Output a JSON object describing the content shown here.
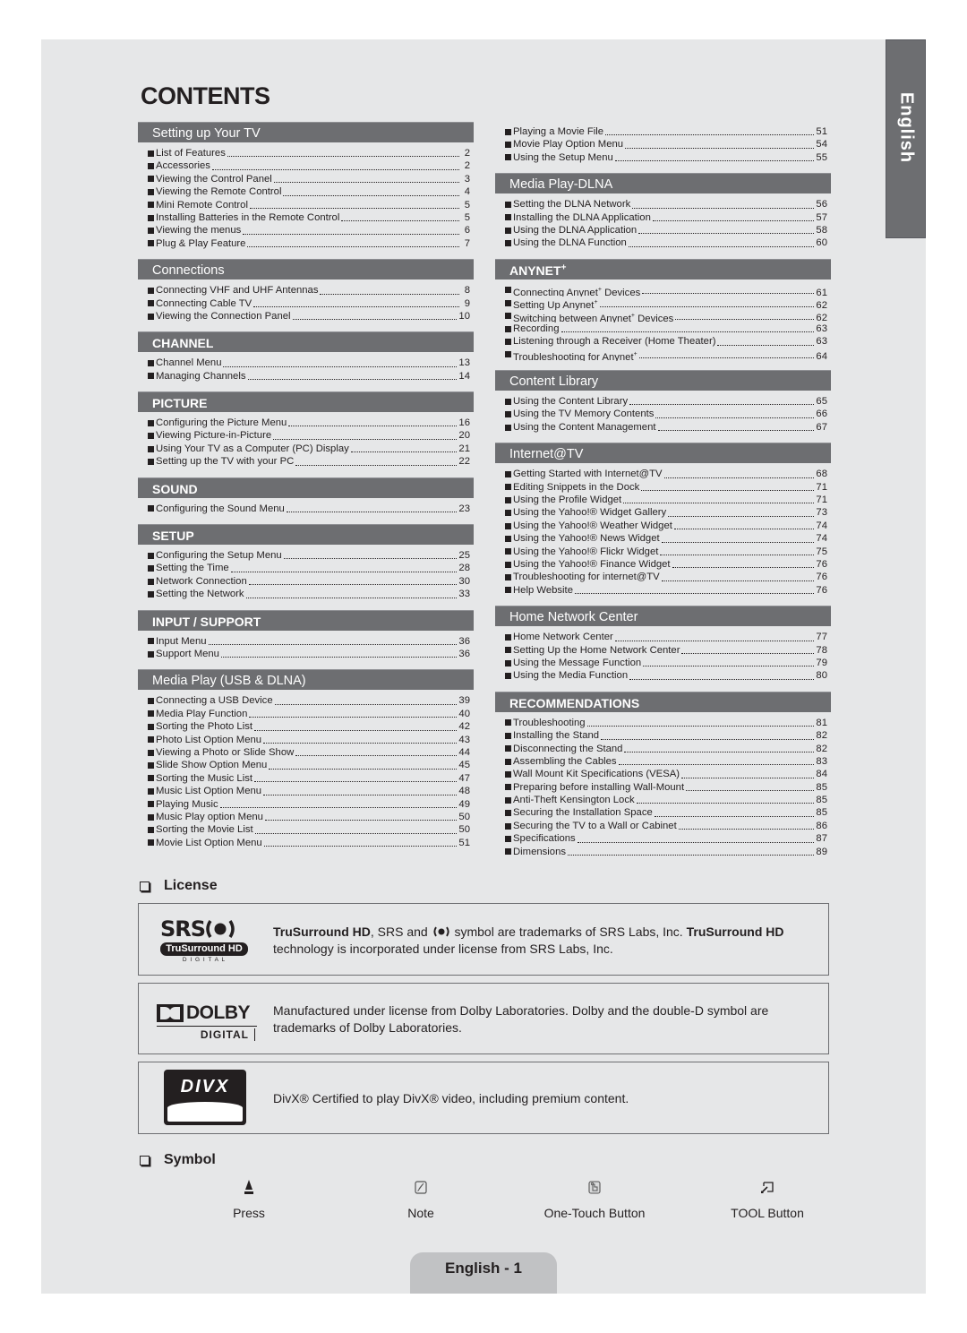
{
  "language_tab": "English",
  "title": "CONTENTS",
  "left_sections": [
    {
      "heading": "Setting up Your TV",
      "style": "plain",
      "items": [
        {
          "label": "List of Features",
          "page": "2"
        },
        {
          "label": "Accessories",
          "page": "2"
        },
        {
          "label": "Viewing the Control Panel",
          "page": "3"
        },
        {
          "label": "Viewing the Remote Control",
          "page": "4"
        },
        {
          "label": "Mini Remote Control",
          "page": "5"
        },
        {
          "label": "Installing Batteries in the Remote Control",
          "page": "5"
        },
        {
          "label": "Viewing the menus",
          "page": "6"
        },
        {
          "label": "Plug & Play Feature",
          "page": "7"
        }
      ]
    },
    {
      "heading": "Connections",
      "style": "plain",
      "items": [
        {
          "label": "Connecting VHF and UHF Antennas",
          "page": "8"
        },
        {
          "label": "Connecting Cable TV",
          "page": "9"
        },
        {
          "label": "Viewing the Connection Panel",
          "page": "10"
        }
      ]
    },
    {
      "heading": "CHANNEL",
      "style": "caps",
      "items": [
        {
          "label": "Channel Menu",
          "page": "13"
        },
        {
          "label": "Managing Channels",
          "page": "14"
        }
      ]
    },
    {
      "heading": "PICTURE",
      "style": "caps",
      "items": [
        {
          "label": "Configuring the Picture Menu",
          "page": "16"
        },
        {
          "label": "Viewing Picture-in-Picture",
          "page": "20"
        },
        {
          "label": "Using Your TV as a Computer (PC) Display",
          "page": "21"
        },
        {
          "label": "Setting up the TV with your PC",
          "page": "22"
        }
      ]
    },
    {
      "heading": "SOUND",
      "style": "caps",
      "items": [
        {
          "label": "Configuring the Sound Menu",
          "page": "23"
        }
      ]
    },
    {
      "heading": "SETUP",
      "style": "caps",
      "items": [
        {
          "label": "Configuring the Setup Menu",
          "page": "25"
        },
        {
          "label": "Setting the Time",
          "page": "28"
        },
        {
          "label": "Network Connection",
          "page": "30"
        },
        {
          "label": "Setting the Network",
          "page": "33"
        }
      ]
    },
    {
      "heading": "INPUT / SUPPORT",
      "style": "caps",
      "items": [
        {
          "label": "Input Menu",
          "page": "36"
        },
        {
          "label": "Support Menu",
          "page": "36"
        }
      ]
    },
    {
      "heading": "Media Play (USB & DLNA)",
      "style": "plain",
      "items": [
        {
          "label": "Connecting a USB Device",
          "page": "39"
        },
        {
          "label": "Media Play Function",
          "page": "40"
        },
        {
          "label": "Sorting the Photo List",
          "page": "42"
        },
        {
          "label": "Photo List Option Menu",
          "page": "43"
        },
        {
          "label": "Viewing a Photo or Slide Show",
          "page": "44"
        },
        {
          "label": "Slide Show Option Menu",
          "page": "45"
        },
        {
          "label": "Sorting the Music List",
          "page": "47"
        },
        {
          "label": "Music List Option Menu",
          "page": "48"
        },
        {
          "label": "Playing Music",
          "page": "49"
        },
        {
          "label": "Music Play option Menu",
          "page": "50"
        },
        {
          "label": "Sorting the Movie List",
          "page": "50"
        },
        {
          "label": "Movie List Option Menu",
          "page": "51"
        }
      ]
    }
  ],
  "right_sections": [
    {
      "heading": "",
      "style": "none",
      "items": [
        {
          "label": "Playing a Movie File",
          "page": "51"
        },
        {
          "label": "Movie Play Option Menu",
          "page": "54"
        },
        {
          "label": "Using the Setup Menu",
          "page": "55"
        }
      ]
    },
    {
      "heading": "Media Play-DLNA",
      "style": "plain",
      "items": [
        {
          "label": "Setting the DLNA Network",
          "page": "56"
        },
        {
          "label": "Installing the DLNA Application",
          "page": "57"
        },
        {
          "label": "Using the DLNA Application",
          "page": "58"
        },
        {
          "label": "Using the DLNA Function",
          "page": "60"
        }
      ]
    },
    {
      "heading": "ANYNET",
      "heading_sup": "+",
      "style": "caps",
      "items": [
        {
          "label": "Connecting Anynet",
          "sup": "+",
          "label_after": " Devices",
          "page": "61"
        },
        {
          "label": "Setting Up Anynet",
          "sup": "+",
          "label_after": "",
          "page": "62"
        },
        {
          "label": "Switching between Anynet",
          "sup": "+",
          "label_after": " Devices",
          "page": "62"
        },
        {
          "label": "Recording",
          "page": "63"
        },
        {
          "label": "Listening through a Receiver (Home Theater)",
          "page": "63"
        },
        {
          "label": "Troubleshooting for Anynet",
          "sup": "+",
          "label_after": "",
          "page": "64"
        }
      ]
    },
    {
      "heading": "Content Library",
      "style": "plain",
      "items": [
        {
          "label": "Using the Content Library",
          "page": "65"
        },
        {
          "label": "Using the TV Memory Contents",
          "page": "66"
        },
        {
          "label": "Using the Content Management",
          "page": "67"
        }
      ]
    },
    {
      "heading": "Internet@TV",
      "style": "plain",
      "items": [
        {
          "label": "Getting Started with Internet@TV",
          "page": "68"
        },
        {
          "label": "Editing Snippets in the Dock",
          "page": "71"
        },
        {
          "label": "Using the Profile Widget",
          "page": "71"
        },
        {
          "label": "Using the Yahoo!® Widget Gallery",
          "page": "73"
        },
        {
          "label": "Using the Yahoo!® Weather Widget",
          "page": "74"
        },
        {
          "label": "Using the Yahoo!® News Widget",
          "page": "74"
        },
        {
          "label": "Using the Yahoo!® Flickr Widget",
          "page": "75"
        },
        {
          "label": "Using the Yahoo!® Finance Widget",
          "page": "76"
        },
        {
          "label": "Troubleshooting for internet@TV",
          "page": "76"
        },
        {
          "label": "Help Website",
          "page": "76"
        }
      ]
    },
    {
      "heading": "Home Network Center",
      "style": "plain",
      "items": [
        {
          "label": "Home Network Center",
          "page": "77"
        },
        {
          "label": "Setting Up the Home Network Center",
          "page": "78"
        },
        {
          "label": "Using the Message Function",
          "page": "79"
        },
        {
          "label": "Using the Media Function",
          "page": "80"
        }
      ]
    },
    {
      "heading": "RECOMMENDATIONS",
      "style": "caps",
      "items": [
        {
          "label": "Troubleshooting",
          "page": "81"
        },
        {
          "label": "Installing the Stand",
          "page": "82"
        },
        {
          "label": "Disconnecting the Stand",
          "page": "82"
        },
        {
          "label": "Assembling the Cables",
          "page": "83"
        },
        {
          "label": "Wall Mount Kit Specifications (VESA)",
          "page": "84"
        },
        {
          "label": "Preparing before installing Wall-Mount",
          "page": "85"
        },
        {
          "label": "Anti-Theft Kensington Lock",
          "page": "85"
        },
        {
          "label": "Securing the Installation Space",
          "page": "85"
        },
        {
          "label": "Securing the TV to a Wall or Cabinet",
          "page": "86"
        },
        {
          "label": "Specifications",
          "page": "87"
        },
        {
          "label": "Dimensions",
          "page": "89"
        }
      ]
    }
  ],
  "license": {
    "heading": "License",
    "srs": {
      "logo_top": "SRS",
      "logo_band": "TruSurround HD",
      "logo_bottom": "D I G I T A L",
      "text_bold_1": "TruSurround HD",
      "text_1": ", SRS and ",
      "text_2": " symbol are trademarks of SRS Labs, Inc. ",
      "text_bold_2": "TruSurround HD",
      "text_3": "technology is incorporated under license from SRS Labs, Inc."
    },
    "dolby": {
      "logo_top": "DOLBY",
      "logo_bottom": "DIGITAL",
      "line_1": "Manufactured under license from Dolby Laboratories. Dolby and the double-D symbol are",
      "line_2": "trademarks of Dolby Laboratories."
    },
    "divx": {
      "logo": "DIVX",
      "text": "DivX® Certified to play DivX® video, including premium content."
    }
  },
  "symbol": {
    "heading": "Symbol",
    "items": [
      {
        "icon": "press-icon",
        "label": "Press"
      },
      {
        "icon": "note-icon",
        "label": "Note"
      },
      {
        "icon": "one-touch-icon",
        "label": "One-Touch Button"
      },
      {
        "icon": "tool-icon",
        "label": "TOOL Button"
      }
    ]
  },
  "footer": {
    "page_label": "English - 1"
  },
  "colors": {
    "section_bar": "#6d6e71",
    "page_bg": "#e6e7e8",
    "footer_tab": "#c1c2c4",
    "text": "#231f20"
  }
}
